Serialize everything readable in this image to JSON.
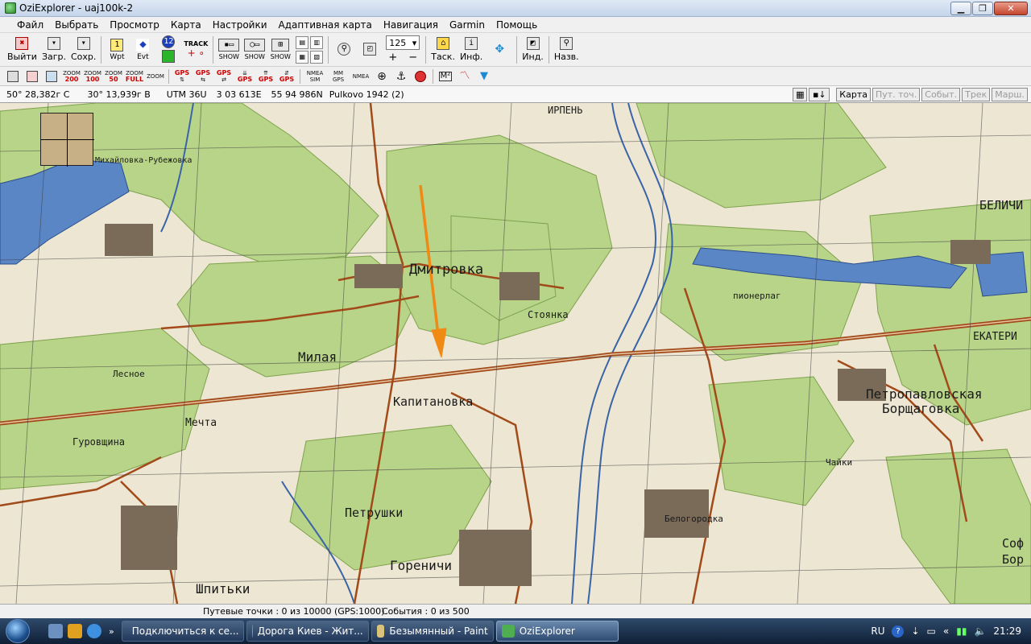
{
  "window": {
    "title": "OziExplorer - uaj100k-2",
    "controls": [
      "▁",
      "❐",
      "✕"
    ]
  },
  "menu": [
    "Файл",
    "Выбрать",
    "Просмотр",
    "Карта",
    "Настройки",
    "Адаптивная карта",
    "Навигация",
    "Garmin",
    "Помощь"
  ],
  "toolbar1": {
    "exit": "Выйти",
    "load": "Загр.",
    "save": "Сохр.",
    "wpt": "Wpt",
    "evt": "Evt",
    "track": "TRACK",
    "show": "SHOW",
    "zoom_value": "125",
    "task": "Таск.",
    "info": "Инф.",
    "ind": "Инд.",
    "name": "Назв."
  },
  "toolbar2": {
    "zoom": [
      "200",
      "100",
      "50",
      "FULL",
      ""
    ],
    "zoom_word": "ZOOM",
    "gps": "GPS",
    "nmea_sim": "NMEA SIM",
    "mm_gps": "MM GPS",
    "nmea": "NMEA"
  },
  "coords": {
    "lat": "50° 28,382г С",
    "lon": "30° 13,939г В",
    "utm": "UTM  36U",
    "east": "3 03 613E",
    "north": "55 94 986N",
    "datum": "Pulkovo 1942 (2)"
  },
  "right_buttons": [
    "Карта",
    "Пут. точ.",
    "Событ.",
    "Трек",
    "Марш."
  ],
  "map_labels": [
    "Дмитровка",
    "Милая",
    "Капитановка",
    "Стоянка",
    "Мечта",
    "Гуровщина",
    "Лесное",
    "Петрушки",
    "Гореничи",
    "Шпитьки",
    "Петропавловская",
    "Борщаговка",
    "Белогородка",
    "ИРПЕНЬ",
    "Чайки",
    "БЕЛИЧИ",
    "ЕКАТЕРИ",
    "Михайловка-Рубежовка",
    "пионерлаг",
    "Соф",
    "Бор"
  ],
  "status": {
    "waypoints": "Путевые точки : 0 из 10000  (GPS:1000)",
    "events": "События : 0 из 500"
  },
  "taskbar": {
    "tasks": [
      "Подключиться к се...",
      "Дорога Киев - Жит...",
      "Безымянный - Paint",
      "OziExplorer"
    ],
    "lang": "RU",
    "time": "21:29"
  },
  "colors": {
    "forest": "#b9d48a",
    "open": "#ece6d2",
    "water": "#5b86c6",
    "road": "#a24a1a",
    "arrow": "#f08a14"
  }
}
